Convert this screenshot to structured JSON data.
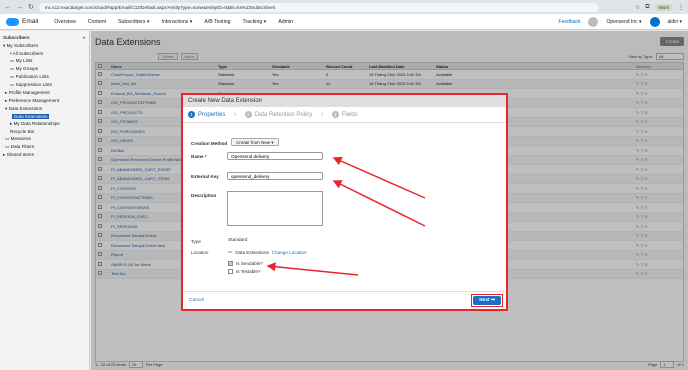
{
  "browser": {
    "url": "mc.s12.exacttarget.com/cloud/#app/Email/C12/Default.aspx?entityType=none&entityID=0&ks=ks%23Subscribers",
    "profile": "Work"
  },
  "appbar": {
    "app_name": "Email",
    "menu": [
      "Overview",
      "Content",
      "Subscribers ▾",
      "Interactions ▾",
      "A/B Testing",
      "Tracking ▾",
      "Admin"
    ],
    "feedback": "Feedback",
    "org": "Opensend Inc ▾",
    "user": "aldin ▾"
  },
  "sidebar": {
    "title": "Subscribers",
    "collapse": "«",
    "items": [
      "▾ My Subscribers",
      "• All Subscribers",
      "My Lists",
      "My Groups",
      "Publication Lists",
      "Suppression Lists",
      "▸ Profile Management",
      "▸ Preference Management",
      "▾ Data Extensions",
      "Data Extensions",
      "▸ My Data Relationships",
      "Recycle Bin",
      "Measures",
      "Data Filters",
      "▸ Shared Items"
    ]
  },
  "main": {
    "title": "Data Extensions",
    "create_label": "Create",
    "toolbar": [
      "Delete",
      "Move"
    ],
    "view_by": "View by Type:",
    "view_by_value": "All",
    "columns": [
      "Name",
      "Type",
      "Sendable",
      "Record Count",
      "Last Modified Date",
      "Status",
      "Actions"
    ],
    "rows": [
      {
        "name": "ClosePropor_TotalUniverse",
        "type": "Standard",
        "sendable": "Yes",
        "count": "0",
        "modified": "16 Tháng Chín 2023 5:42 SA",
        "status": "Available"
      },
      {
        "name": "hmbr_test_list",
        "type": "Standard",
        "sendable": "Yes",
        "count": "12",
        "modified": "16 Tháng Chín 2023 5:42 SA",
        "status": "Available"
      },
      {
        "name": "Endorai_BO_Medicine_Scores",
        "type": "Standard",
        "sendable": "",
        "count": "",
        "modified": "",
        "status": ""
      },
      {
        "name": "ISO_PRODUCTATTRIBS",
        "type": "",
        "sendable": "",
        "count": "",
        "modified": "",
        "status": ""
      },
      {
        "name": "ISO_PRODUCTS",
        "type": "",
        "sendable": "",
        "count": "",
        "modified": "",
        "status": ""
      },
      {
        "name": "ISO_PROMOS",
        "type": "",
        "sendable": "",
        "count": "",
        "modified": "",
        "status": ""
      },
      {
        "name": "ISO_PURCHASES",
        "type": "",
        "sendable": "",
        "count": "",
        "modified": "",
        "status": ""
      },
      {
        "name": "ISO_VIEWS",
        "type": "",
        "sendable": "",
        "count": "",
        "modified": "",
        "status": ""
      },
      {
        "name": "Kill Bull",
        "type": "",
        "sendable": "",
        "count": "",
        "modified": "",
        "status": ""
      },
      {
        "name": "Opensend Recurrent Device Profile Ma",
        "type": "",
        "sendable": "",
        "count": "",
        "modified": "",
        "status": ""
      },
      {
        "name": "PI_ABANDONED_CART_EVENT",
        "type": "",
        "sendable": "",
        "count": "",
        "modified": "",
        "status": ""
      },
      {
        "name": "PI_ABANDONED_CART_ITEMS",
        "type": "",
        "sendable": "",
        "count": "",
        "modified": "",
        "status": ""
      },
      {
        "name": "PI_CONTENT",
        "type": "",
        "sendable": "",
        "count": "",
        "modified": "",
        "status": ""
      },
      {
        "name": "PI_CONTENTATTRIBS",
        "type": "",
        "sendable": "",
        "count": "",
        "modified": "",
        "status": ""
      },
      {
        "name": "PI_CONTENTVIEWS",
        "type": "",
        "sendable": "",
        "count": "",
        "modified": "",
        "status": ""
      },
      {
        "name": "PI_SESSION_EXEC",
        "type": "",
        "sendable": "",
        "count": "",
        "modified": "",
        "status": ""
      },
      {
        "name": "PI_SESSIONS",
        "type": "",
        "sendable": "",
        "count": "",
        "modified": "",
        "status": ""
      },
      {
        "name": "Recovered Sample Event",
        "type": "",
        "sendable": "",
        "count": "",
        "modified": "",
        "status": ""
      },
      {
        "name": "Recovered Sample Event Item",
        "type": "",
        "sendable": "",
        "count": "",
        "modified": "",
        "status": ""
      },
      {
        "name": "Report",
        "type": "",
        "sendable": "",
        "count": "",
        "modified": "",
        "status": ""
      },
      {
        "name": "SAMPLE DE for Alerts",
        "type": "",
        "sendable": "",
        "count": "",
        "modified": "",
        "status": ""
      },
      {
        "name": "Test Bot",
        "type": "",
        "sendable": "",
        "count": "",
        "modified": "",
        "status": ""
      }
    ],
    "footer_range": "1 - 22 of 22 items",
    "per_page_value": "25",
    "per_page_label": "Per Page",
    "page_label": "Page",
    "page_value": "1",
    "page_of": "of 1"
  },
  "modal": {
    "title": "Create New Data Extension",
    "steps": [
      {
        "num": "1",
        "label": "Properties"
      },
      {
        "num": "2",
        "label": "Data Retention Policy"
      },
      {
        "num": "3",
        "label": "Fields"
      }
    ],
    "creation_method_label": "Creation Method",
    "creation_method_value": "Create from New",
    "name_label": "Name",
    "name_req": "*",
    "name_value": "Opensend delivery",
    "external_key_label": "External Key",
    "external_key_value": "opensend_delivery",
    "description_label": "Description",
    "type_label": "Type",
    "type_value": "Standard",
    "location_label": "Location",
    "location_value": "Data Extensions",
    "change_location": "Change Location",
    "sendable_label": "Is Sendable?",
    "sendable_checked": true,
    "testable_label": "Is Testable?",
    "testable_checked": false,
    "cancel_label": "Cancel",
    "next_label": "Next ➡"
  },
  "colors": {
    "accent": "#1a6fc4",
    "annotation": "#e8252a",
    "brand": "#1b96ff"
  }
}
